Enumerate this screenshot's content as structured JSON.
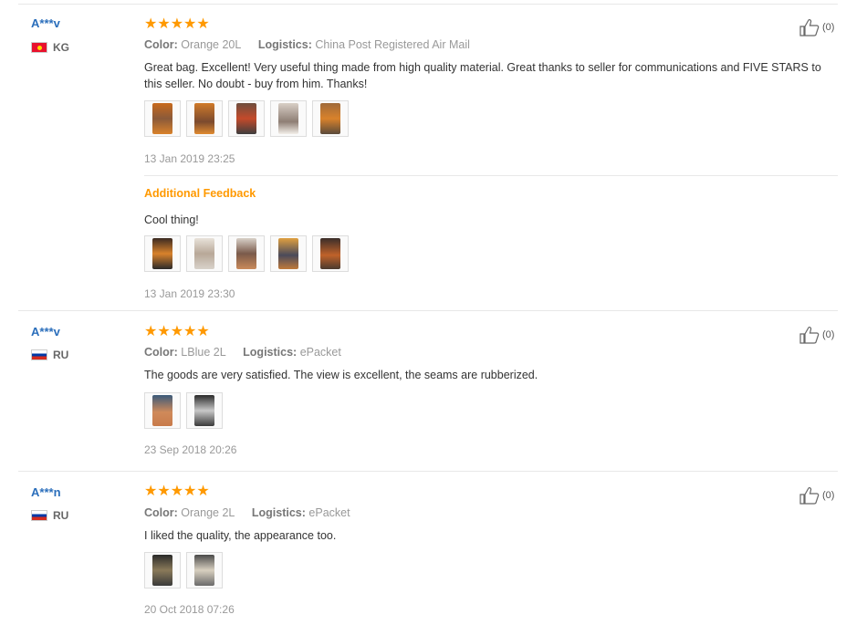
{
  "reviews": [
    {
      "user": "A***v",
      "country": "KG",
      "stars": "★★★★★",
      "color_label": "Color:",
      "color_value": "Orange 20L",
      "logistics_label": "Logistics:",
      "logistics_value": "China Post Registered Air Mail",
      "text": "Great bag. Excellent! Very useful thing made from high quality material. Great thanks to seller for communications and FIVE STARS to this seller. No doubt - buy from him. Thanks!",
      "date": "13 Jan 2019 23:25",
      "likes": "(0)",
      "additional_label": "Additional Feedback",
      "additional_text": "Cool thing!",
      "additional_date": "13 Jan 2019 23:30"
    },
    {
      "user": "A***v",
      "country": "RU",
      "stars": "★★★★★",
      "color_label": "Color:",
      "color_value": "LBlue 2L",
      "logistics_label": "Logistics:",
      "logistics_value": "ePacket",
      "text": "The goods are very satisfied. The view is excellent, the seams are rubberized.",
      "date": "23 Sep 2018 20:26",
      "likes": "(0)"
    },
    {
      "user": "A***n",
      "country": "RU",
      "stars": "★★★★★",
      "color_label": "Color:",
      "color_value": "Orange 2L",
      "logistics_label": "Logistics:",
      "logistics_value": "ePacket",
      "text": "I liked the quality, the appearance too.",
      "date": "20 Oct 2018 07:26",
      "likes": "(0)"
    }
  ],
  "icons": {
    "like": "thumbs-up-icon",
    "star": "star-icon"
  },
  "colors": {
    "accent": "#ff9900",
    "link": "#2a6ebb"
  }
}
